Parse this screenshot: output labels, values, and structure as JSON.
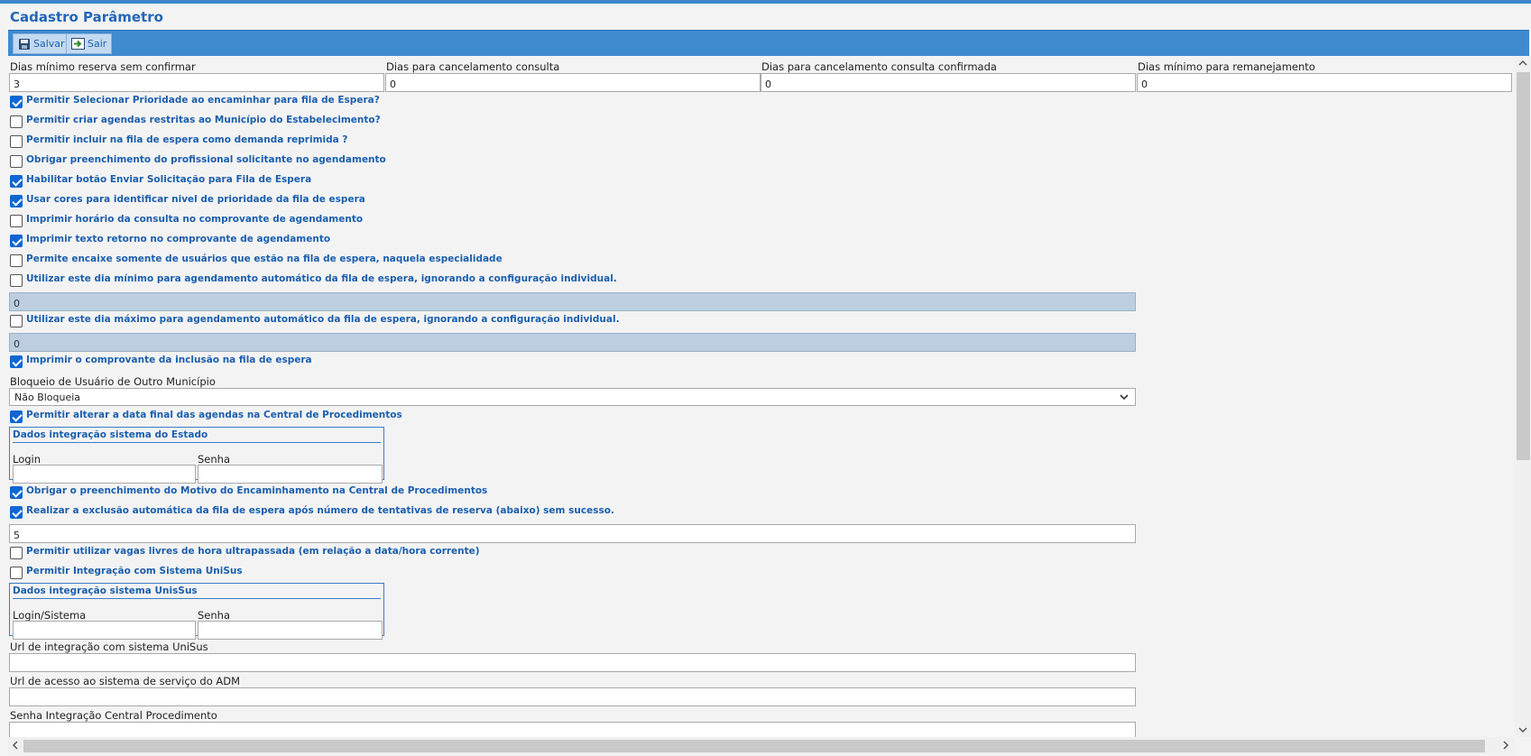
{
  "page": {
    "title": "Cadastro Parâmetro"
  },
  "toolbar": {
    "save_label": "Salvar",
    "exit_label": "Sair"
  },
  "top_fields": [
    {
      "label": "Dias mínimo reserva sem confirmar",
      "value": "3"
    },
    {
      "label": "Dias para cancelamento consulta",
      "value": "0"
    },
    {
      "label": "Dias para cancelamento consulta confirmada",
      "value": "0"
    },
    {
      "label": "Dias mínimo para remanejamento",
      "value": "0"
    }
  ],
  "options": [
    {
      "label": "Permitir Selecionar Prioridade ao encaminhar para fila de Espera?",
      "checked": true
    },
    {
      "label": "Permitir criar agendas restritas ao Município do Estabelecimento?",
      "checked": false
    },
    {
      "label": "Permitir incluir na fila de espera como demanda reprimida ?",
      "checked": false
    },
    {
      "label": "Obrigar preenchimento do profissional solicitante no agendamento",
      "checked": false
    },
    {
      "label": "Habilitar botão Enviar Solicitação para Fila de Espera",
      "checked": true
    },
    {
      "label": "Usar cores para identificar nivel de prioridade da fila de espera",
      "checked": true
    },
    {
      "label": "Imprimir horário da consulta no comprovante de agendamento",
      "checked": false
    },
    {
      "label": "Imprimir texto retorno no comprovante de agendamento",
      "checked": true
    },
    {
      "label": "Permite encaixe somente de usuários que estão na fila de espera, naquela especialidade",
      "checked": false
    },
    {
      "label": "Utilizar este dia mínimo para agendamento automático da fila de espera, ignorando a configuração individual.",
      "checked": false
    },
    {
      "label": "Utilizar este dia máximo para agendamento automático da fila de espera, ignorando a configuração individual.",
      "checked": false
    },
    {
      "label": "Imprimir o comprovante da inclusão na fila de espera",
      "checked": true
    },
    {
      "label": "Permitir alterar a data final das agendas na Central de Procedimentos",
      "checked": true
    },
    {
      "label": "Obrigar o preenchimento do Motivo do Encaminhamento na Central de Procedimentos",
      "checked": true
    },
    {
      "label": "Realizar a exclusão automática da fila de espera após número de tentativas de reserva (abaixo) sem sucesso.",
      "checked": true
    },
    {
      "label": "Permitir utilizar vagas livres de hora ultrapassada (em relação a data/hora corrente)",
      "checked": false
    },
    {
      "label": "Permitir Integração com Sistema UniSus",
      "checked": false
    }
  ],
  "min_day_value": "0",
  "max_day_value": "0",
  "blocking": {
    "label": "Bloqueio de Usuário de Outro Município",
    "selected": "Não Bloqueia"
  },
  "state_integration": {
    "legend": "Dados integração sistema do Estado",
    "login_label": "Login",
    "password_label": "Senha",
    "login_value": "",
    "password_value": ""
  },
  "attempts_value": "5",
  "unisus_integration": {
    "legend": "Dados integração sistema UnisSus",
    "login_label": "Login/Sistema",
    "password_label": "Senha",
    "login_value": "",
    "password_value": ""
  },
  "unisus_url": {
    "label": "Url de integração com sistema UniSus",
    "value": ""
  },
  "adm_url": {
    "label": "Url de acesso ao sistema de serviço do ADM",
    "value": ""
  },
  "central_password": {
    "label": "Senha Integração Central Procedimento",
    "value": ""
  },
  "colors": {
    "accent": "#3e8bd0",
    "title": "#2366b8",
    "checkbox": "#0f67d1"
  }
}
